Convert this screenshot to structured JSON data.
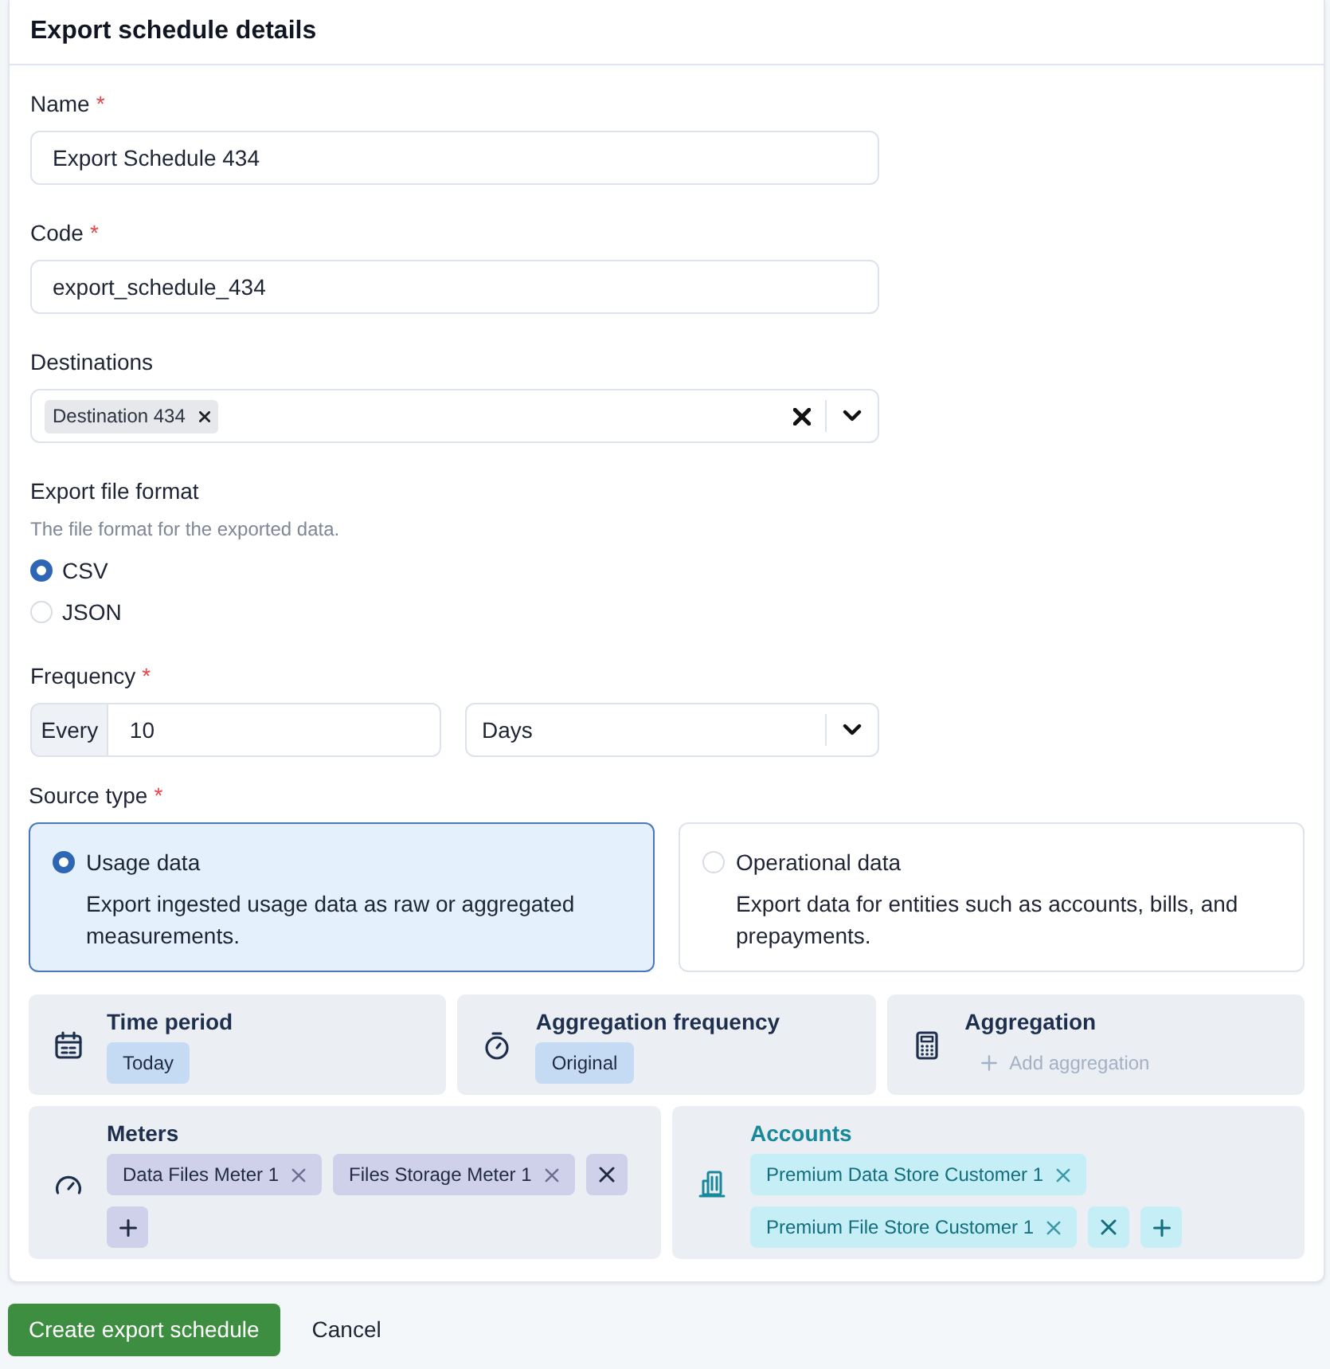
{
  "title": "Export schedule details",
  "fields": [
    {
      "kind": "text",
      "label": "Name",
      "required_mark": "*",
      "value": "Export Schedule 434"
    },
    {
      "kind": "text",
      "label": "Code",
      "required_mark": "*",
      "value": "export_schedule_434"
    },
    {
      "kind": "multiselect",
      "label": "Destinations",
      "tags": [
        "Destination 434"
      ]
    },
    {
      "kind": "radio",
      "label": "Export file format",
      "help": "The file format for the exported data.",
      "options": [
        {
          "label": "CSV",
          "selected": true
        },
        {
          "label": "JSON",
          "selected": false
        }
      ]
    },
    {
      "kind": "frequency",
      "label": "Frequency",
      "required_mark": "*",
      "prefix": "Every",
      "value": "10",
      "unit": "Days"
    },
    {
      "kind": "cards",
      "label": "Source type",
      "required_mark": "*",
      "options": [
        {
          "title": "Usage data",
          "description": "Export ingested usage data as raw or aggregated measurements.",
          "selected": true
        },
        {
          "title": "Operational data",
          "description": "Export data for entities such as accounts, bills, and prepayments.",
          "selected": false
        }
      ]
    }
  ],
  "panel_rows": [
    {
      "panels": [
        {
          "kind": "value",
          "title": "Time period",
          "selected": false,
          "color": "#c5daf3",
          "values": [
            "Today"
          ]
        },
        {
          "kind": "value",
          "title": "Aggregation frequency",
          "selected": false,
          "color": "#c5daf3",
          "values": [
            "Original"
          ]
        },
        {
          "kind": "add",
          "title": "Aggregation",
          "selected": false,
          "add_label": "Add aggregation"
        }
      ]
    },
    {
      "panels": [
        {
          "kind": "list",
          "title": "Meters",
          "selected": false,
          "color": "#cfd1ea",
          "values": [
            "Data Files Meter 1",
            "Files Storage Meter 1"
          ]
        },
        {
          "kind": "list",
          "title": "Accounts",
          "selected": true,
          "color": "#c5eef6",
          "values": [
            "Premium Data Store Customer 1",
            "Premium File Store Customer 1"
          ]
        }
      ]
    }
  ],
  "actions": [
    {
      "kind": "primary",
      "label": "Create export schedule"
    },
    {
      "kind": "link",
      "label": "Cancel"
    }
  ]
}
